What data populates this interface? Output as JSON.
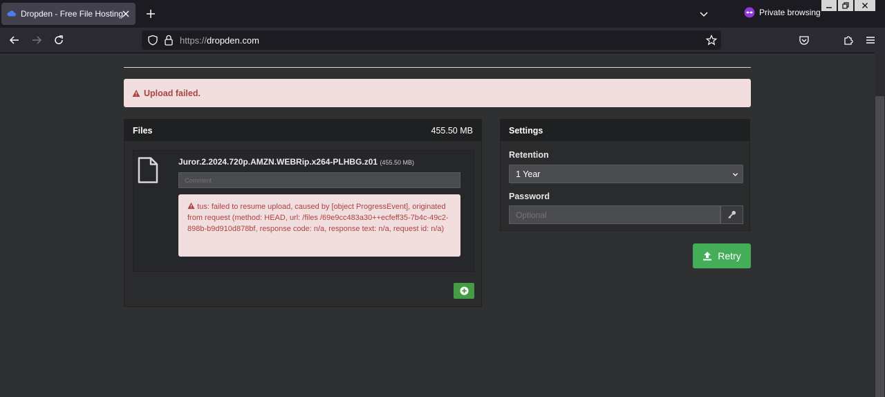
{
  "browser": {
    "tab_title": "Dropden - Free File Hosting",
    "private_label": "Private browsing",
    "url_protocol": "https://",
    "url_host": "dropden.com"
  },
  "page": {
    "alert": "Upload failed.",
    "files_panel": {
      "title": "Files",
      "total_size": "455.50 MB",
      "file": {
        "name": "Juror.2.2024.720p.AMZN.WEBRip.x264-PLHBG.z01",
        "size": "(455.50 MB)",
        "comment_placeholder": "Comment",
        "error": "tus: failed to resume upload, caused by [object ProgressEvent], originated from request (method: HEAD, url: /files /69e9cc483a30++ecfeff35-7b4c-49c2-898b-b9d910d878bf, response code: n/a, response text: n/a, request id: n/a)"
      }
    },
    "settings_panel": {
      "title": "Settings",
      "retention_label": "Retention",
      "retention_value": "1 Year",
      "password_label": "Password",
      "password_placeholder": "Optional"
    },
    "retry_label": "Retry"
  },
  "colors": {
    "alert_bg": "#f2dede",
    "alert_text": "#a94442",
    "success_green": "#44ad58",
    "page_bg": "#2f3032"
  },
  "icons": {
    "tab": "dropden-cloud-icon",
    "alert": "warning-icon",
    "file": "file-icon",
    "add": "plus-circle-icon",
    "password": "key-icon",
    "retry": "upload-icon"
  }
}
